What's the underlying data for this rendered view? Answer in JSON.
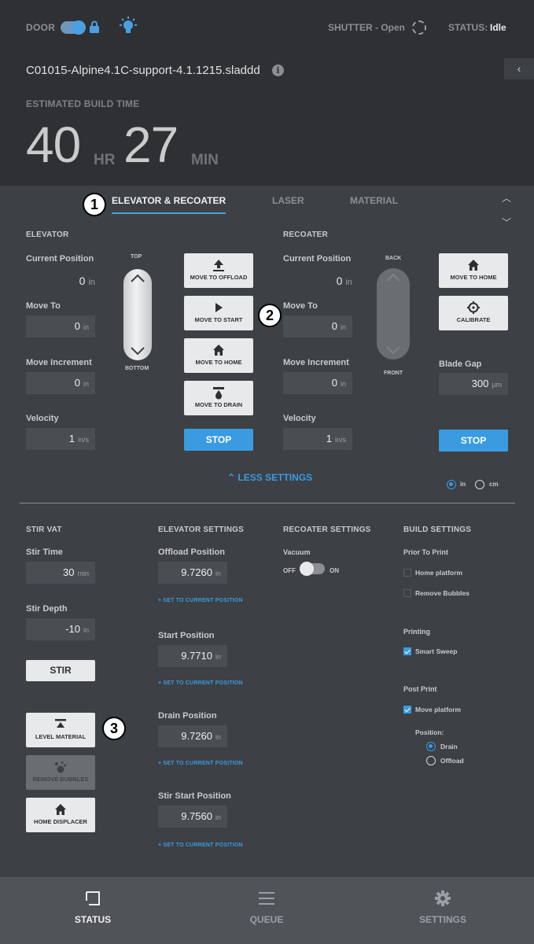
{
  "header": {
    "door_label": "DOOR",
    "shutter_label": "SHUTTER - Open",
    "status_label": "STATUS:",
    "status_value": "Idle",
    "file_name": "C01015-Alpine4.1C-support-4.1.1215.sladdd",
    "info_glyph": "i",
    "collapse_glyph": "‹",
    "estimated_label": "ESTIMATED BUILD TIME",
    "hours": "40",
    "hours_unit": "HR",
    "minutes": "27",
    "minutes_unit": "MIN"
  },
  "tabs": [
    {
      "label": "ELEVATOR & RECOATER",
      "active": true
    },
    {
      "label": "LASER",
      "active": false
    },
    {
      "label": "MATERIAL",
      "active": false
    }
  ],
  "callouts": [
    "1",
    "2",
    "3"
  ],
  "elevator": {
    "title": "ELEVATOR",
    "current_position_label": "Current Position",
    "current_position_value": "0",
    "unit": "in",
    "move_to_label": "Move To",
    "move_to_value": "0",
    "move_increment_label": "Move Increment",
    "move_increment_value": "0",
    "velocity_label": "Velocity",
    "velocity_value": "1",
    "velocity_unit": "in/s",
    "jog_top": "TOP",
    "jog_bottom": "BOTTOM",
    "btn_move_offload": "MOVE TO OFFLOAD",
    "btn_move_start": "MOVE TO START",
    "btn_move_home": "MOVE TO HOME",
    "btn_move_drain": "MOVE TO DRAIN",
    "btn_stop": "STOP"
  },
  "recoater": {
    "title": "RECOATER",
    "current_position_label": "Current Position",
    "current_position_value": "0",
    "unit": "in",
    "move_to_label": "Move To",
    "move_to_value": "0",
    "move_increment_label": "Move Increment",
    "move_increment_value": "0",
    "velocity_label": "Velocity",
    "velocity_value": "1",
    "velocity_unit": "in/s",
    "jog_back": "BACK",
    "jog_front": "FRONT",
    "btn_move_home": "MOVE TO HOME",
    "btn_calibrate": "CALIBRATE",
    "blade_gap_label": "Blade Gap",
    "blade_gap_value": "300",
    "blade_gap_unit": "µm",
    "btn_stop": "STOP"
  },
  "less_settings": "LESS SETTINGS",
  "units": {
    "in": "in",
    "cm": "cm",
    "selected": "in"
  },
  "stir_vat": {
    "title": "STIR VAT",
    "stir_time_label": "Stir Time",
    "stir_time_value": "30",
    "stir_time_unit": "min",
    "stir_depth_label": "Stir Depth",
    "stir_depth_value": "-10",
    "stir_depth_unit": "in",
    "btn_stir": "STIR",
    "btn_level_material": "LEVEL MATERIAL",
    "btn_remove_bubbles": "REMOVE BUBBLES",
    "btn_home_displacer": "HOME DISPLACER"
  },
  "elevator_settings": {
    "title": "ELEVATOR SETTINGS",
    "offload_label": "Offload Position",
    "offload_value": "9.7260",
    "start_label": "Start Position",
    "start_value": "9.7710",
    "drain_label": "Drain Position",
    "drain_value": "9.7260",
    "stir_start_label": "Stir Start Position",
    "stir_start_value": "9.7560",
    "unit": "in",
    "set_link": "+ SET TO CURRENT POSITION"
  },
  "recoater_settings": {
    "title": "RECOATER SETTINGS",
    "vacuum_label": "Vacuum",
    "off": "OFF",
    "on": "ON"
  },
  "build_settings": {
    "title": "BUILD SETTINGS",
    "prior_label": "Prior To Print",
    "home_platform": "Home platform",
    "remove_bubbles": "Remove Bubbles",
    "printing_label": "Printing",
    "smart_sweep": "Smart Sweep",
    "post_print_label": "Post Print",
    "move_platform": "Move platform",
    "position_label": "Position:",
    "drain": "Drain",
    "offload": "Offload"
  },
  "nav": {
    "status": "STATUS",
    "queue": "QUEUE",
    "settings": "SETTINGS"
  },
  "colors": {
    "accent": "#3a9be0",
    "header_bg": "#2e3034",
    "panel_bg": "#3d4044"
  }
}
